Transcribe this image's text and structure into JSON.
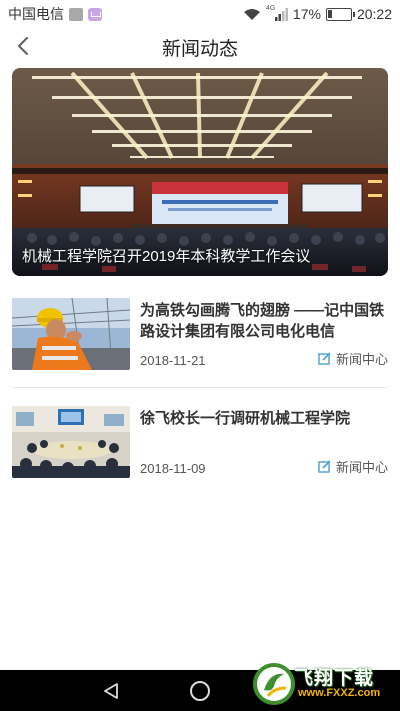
{
  "status_bar": {
    "carrier": "中国电信",
    "network": "4G",
    "battery_percent": "17%",
    "battery_level": 0.17,
    "time": "20:22"
  },
  "header": {
    "title": "新闻动态"
  },
  "featured": {
    "caption": "机械工程学院召开2019年本科教学工作会议"
  },
  "news": [
    {
      "title": "为高铁勾画腾飞的翅膀 ——记中国铁路设计集团有限公司电化电信",
      "date": "2018-11-21",
      "source": "新闻中心"
    },
    {
      "title": "徐飞校长一行调研机械工程学院",
      "date": "2018-11-09",
      "source": "新闻中心"
    }
  ],
  "watermark": {
    "brand": "飞翔下载",
    "url": "www.FXXZ.com"
  },
  "colors": {
    "accent_icon": "#4a9fd6",
    "text_primary": "#333333",
    "divider": "#e8e8e8"
  }
}
